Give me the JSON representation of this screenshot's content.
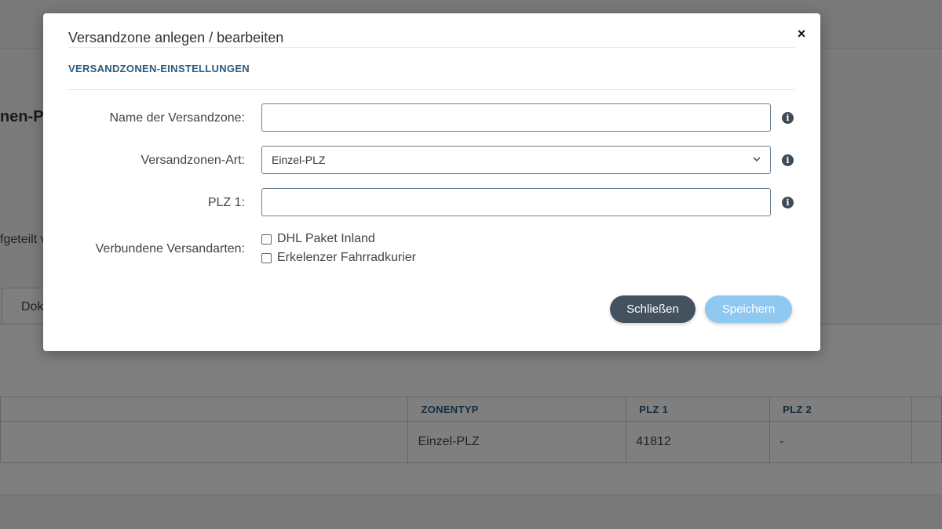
{
  "background": {
    "heading_fragment": "nen-Pl",
    "text_fragment": "fgeteilt v",
    "tab_fragment": "Dok",
    "table": {
      "headers": [
        "",
        "ZONENTYP",
        "PLZ 1",
        "PLZ 2",
        ""
      ],
      "rows": [
        [
          "",
          "Einzel-PLZ",
          "41812",
          "-",
          ""
        ]
      ]
    }
  },
  "modal": {
    "title": "Versandzone anlegen / bearbeiten",
    "close_label": "×",
    "section_title": "VERSANDZONEN-EINSTELLUNGEN",
    "fields": {
      "name": {
        "label": "Name der Versandzone:",
        "value": ""
      },
      "type": {
        "label": "Versandzonen-Art:",
        "value": "Einzel-PLZ"
      },
      "plz1": {
        "label": "PLZ 1:",
        "value": ""
      },
      "methods": {
        "label": "Verbundene Versandarten:",
        "options": [
          "DHL Paket Inland",
          "Erkelenzer Fahrradkurier"
        ]
      }
    },
    "info_glyph": "i",
    "buttons": {
      "close": "Schließen",
      "save": "Speichern"
    }
  },
  "colors": {
    "accent": "#2b5a7d",
    "close_button": "#44525f",
    "save_button": "#8fc8f0"
  }
}
